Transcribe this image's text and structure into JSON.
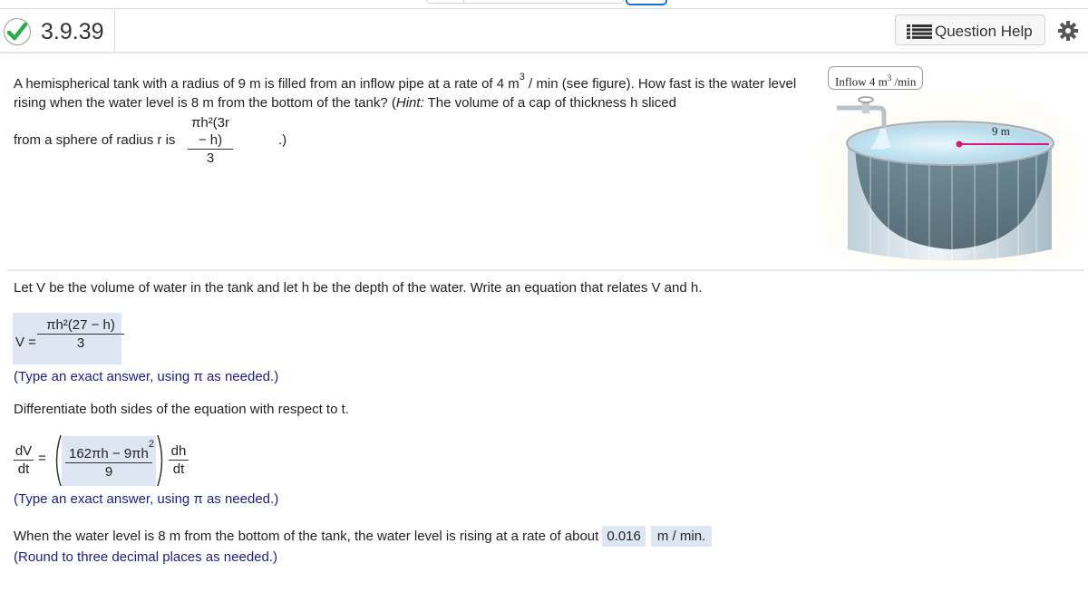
{
  "header": {
    "status": "correct",
    "question_number": "3.9.39",
    "help_label": "Question Help"
  },
  "problem": {
    "line1_a": "A hemispherical tank with a radius of 9 m is filled from an inflow pipe at a rate of 4 m",
    "line1_sup": "3",
    "line1_b": " / min (see figure). How fast is the water level rising when the water level is 8 m from the bottom of the tank? (",
    "hint_label": "Hint:",
    "line1_c": " The volume of a cap of thickness h sliced",
    "hint_lead": "from a sphere of radius r is",
    "hint_formula_num": "πh²(3r − h)",
    "hint_formula_den": "3",
    "hint_close": ".)"
  },
  "figure": {
    "inflow_label": "Inflow 4 m",
    "inflow_sup": "3",
    "inflow_unit": " /min",
    "radius_label": "9 m",
    "colors": {
      "radius_line": "#e0157a",
      "water": "#bfe3f4",
      "tank": "#8fa6b3"
    }
  },
  "step1": {
    "prompt": "Let V be the volume of water in the tank and let h be the depth of the water. Write an equation that relates V and h.",
    "lhs": "V =",
    "answer_num": "πh²(27 − h)",
    "answer_den": "3",
    "note": "(Type an exact answer, using π as needed.)"
  },
  "step2": {
    "prompt": "Differentiate both sides of the equation with respect to t.",
    "lhs_num": "dV",
    "lhs_den": "dt",
    "equals": "=",
    "answer_num_a": "162πh − 9πh",
    "answer_num_sup": "2",
    "answer_den": "9",
    "rhs_num": "dh",
    "rhs_den": "dt",
    "note": "(Type an exact answer, using π as needed.)"
  },
  "step3": {
    "prompt": "When the water level is 8 m from the bottom of the tank, the water level is rising at a rate of about",
    "answer": "0.016",
    "unit": "m / min.",
    "note": "(Round to three decimal places as needed.)"
  },
  "colors": {
    "answer_bg": "#dde6f2",
    "note_text": "#1c1c8c",
    "check_green": "#2bab4b"
  }
}
